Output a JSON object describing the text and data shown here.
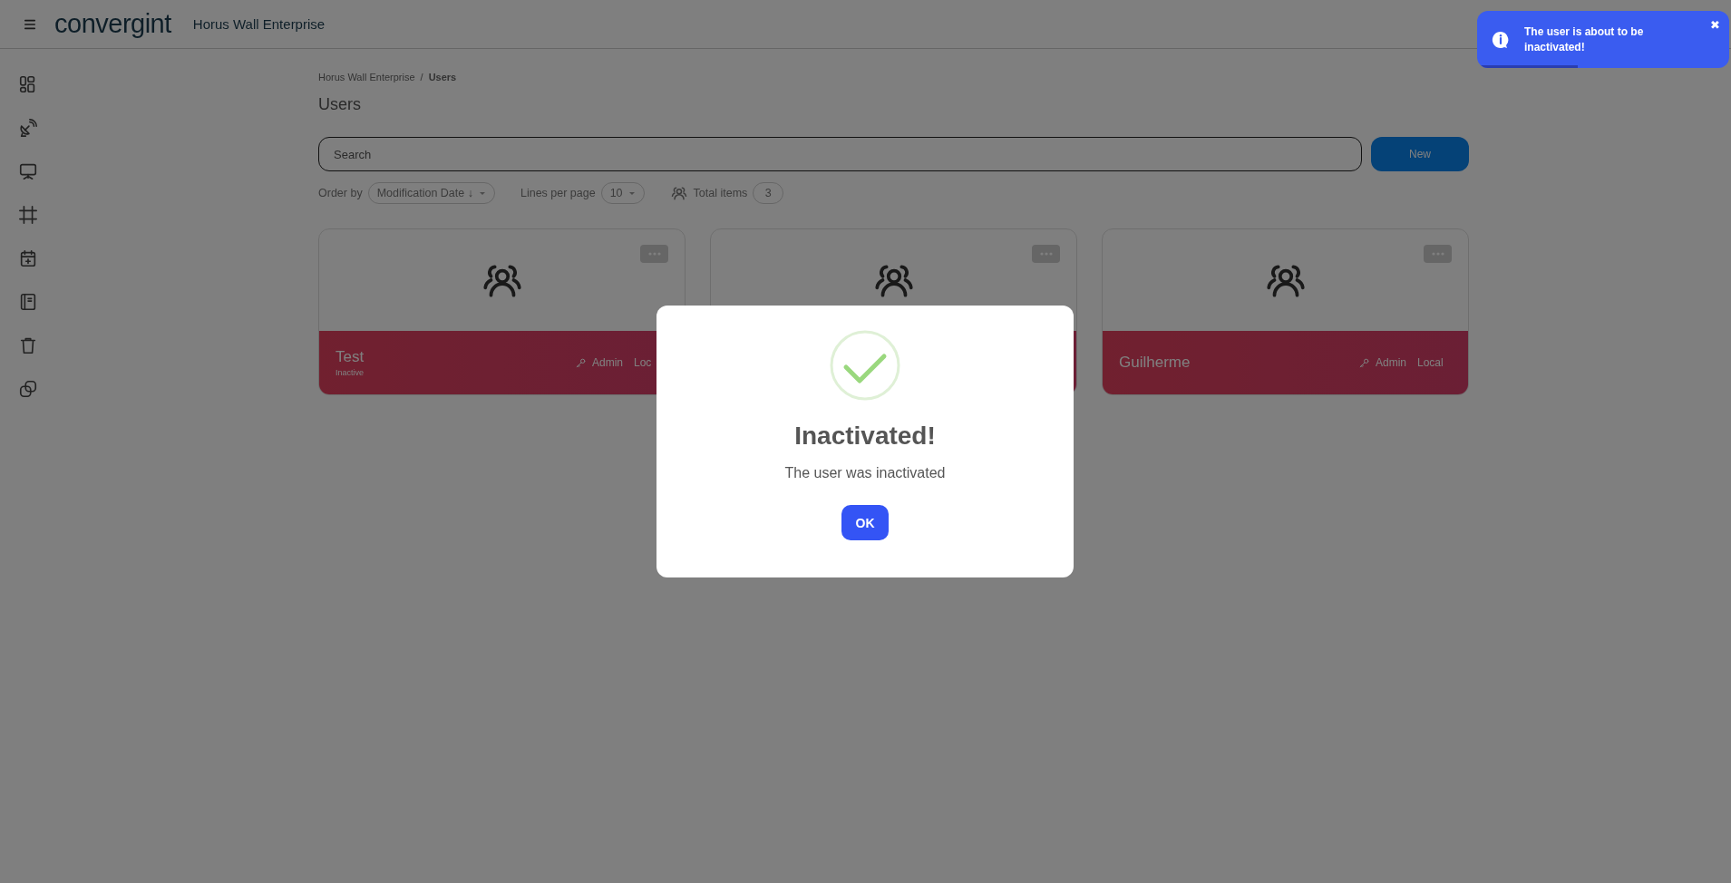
{
  "header": {
    "logo": "convergint",
    "app_title": "Horus Wall Enterprise"
  },
  "breadcrumb": {
    "separator": "/",
    "items": [
      {
        "label": "Horus Wall Enterprise",
        "current": false
      },
      {
        "label": "Users",
        "current": true
      }
    ]
  },
  "page_title": "Users",
  "search": {
    "placeholder": "Search"
  },
  "new_button": "New",
  "toolbar": {
    "order_by_label": "Order by",
    "order_by_value": "Modification Date ↓",
    "lines_label": "Lines per page",
    "lines_value": "10",
    "total_label": "Total items",
    "total_value": "3"
  },
  "cards": [
    {
      "kind": "user",
      "name": "Test",
      "status": "Inactive",
      "role": "Admin",
      "source": "Loc"
    },
    {
      "kind": "user"
    },
    {
      "kind": "user",
      "name": "Guilherme",
      "role": "Admin",
      "source": "Local"
    }
  ],
  "modal": {
    "title": "Inactivated!",
    "message": "The user was inactivated",
    "button": "OK"
  },
  "toast": {
    "message": "The user is about to be inactivated!",
    "close": "✖",
    "level": 0.4
  }
}
